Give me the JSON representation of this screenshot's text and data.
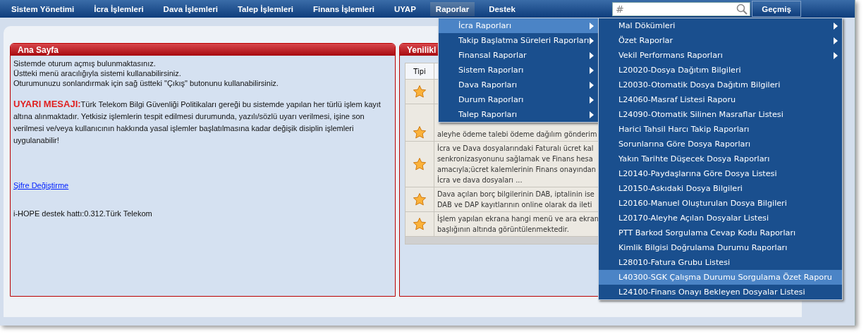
{
  "nav": {
    "items": [
      {
        "label": "Sistem Yönetimi",
        "selected": false
      },
      {
        "label": "İcra İşlemleri",
        "selected": false
      },
      {
        "label": "Dava İşlemleri",
        "selected": false
      },
      {
        "label": "Talep İşlemleri",
        "selected": false
      },
      {
        "label": "Finans İşlemleri",
        "selected": false
      },
      {
        "label": "UYAP",
        "selected": false
      },
      {
        "label": "Raporlar",
        "selected": true
      },
      {
        "label": "Destek",
        "selected": false
      }
    ],
    "search": {
      "placeholder": "#"
    },
    "history_button": "Geçmiş"
  },
  "home_panel": {
    "title": "Ana Sayfa",
    "lines": [
      "Sistemde oturum açmış bulunmaktasınız.",
      "Üstteki menü aracılığıyla sistemi kullanabilirsiniz.",
      "Oturumunuzu sonlandırmak için sağ üstteki \"Çıkış\" butonunu kullanabilirsiniz."
    ],
    "warning": "**UYARI MESAJI:**Türk Telekom Bilgi Güvenliği Politikaları gereği bu sistemde yapılan her türlü işlem kayıt altına alınmaktadır. Yetkisiz işlemlerin tespit edilmesi durumunda, yazılı/sözlü uyarı verilmesi, işine son verilmesi ve/veya kullanıcının hakkında yasal işlemler başlatılmasına kadar değişik disiplin işlemleri uygulanabilir!",
    "password_link": "Şifre Değiştirme",
    "support_line": "i-HOPE destek hattı:0.312.Türk Telekom"
  },
  "news_panel": {
    "title": "Yenilikl",
    "columns": [
      "Tipi"
    ],
    "rows": [
      {
        "kind": "star"
      },
      {
        "kind": "star",
        "lines": [
          "aleyhe ödeme talebi ödeme dağılım gönderim"
        ]
      },
      {
        "kind": "star",
        "lines": [
          "İcra ve Dava dosyalarındaki Faturalı ücret kal",
          "senkronizasyonunu sağlamak ve Finans hesa",
          "amacıyla;ücret kalemlerinin Finans onayından",
          "İcra ve dava dosyaları ..."
        ]
      },
      {
        "kind": "star",
        "lines": [
          "Dava açılan borç bilgilerinin DAB, iptalinin ise",
          "DAB ve DAP kayıtlarının online olarak da ileti"
        ]
      },
      {
        "kind": "star",
        "lines": [
          "İşlem yapılan ekrana hangi menü ve ara ekran",
          "başlığının altında görüntülenmektedir."
        ]
      }
    ]
  },
  "reports_menu": {
    "items": [
      {
        "label": "İcra Raporları",
        "submenu": true,
        "selected": true
      },
      {
        "label": "Takip Başlatma Süreleri Raporları",
        "submenu": true,
        "selected": false
      },
      {
        "label": "Finansal Raporlar",
        "submenu": true,
        "selected": false
      },
      {
        "label": "Sistem Raporları",
        "submenu": true,
        "selected": false
      },
      {
        "label": "Dava Raporları",
        "submenu": true,
        "selected": false
      },
      {
        "label": "Durum Raporları",
        "submenu": true,
        "selected": false
      },
      {
        "label": "Talep Raporları",
        "submenu": true,
        "selected": false
      }
    ]
  },
  "icra_submenu": {
    "items": [
      {
        "label": "Mal Dökümleri",
        "submenu": true,
        "selected": false
      },
      {
        "label": "Özet Raporlar",
        "submenu": true,
        "selected": false
      },
      {
        "label": "Vekil Performans Raporları",
        "submenu": true,
        "selected": false
      },
      {
        "label": "L20020-Dosya Dağıtım Bilgileri",
        "submenu": false,
        "selected": false
      },
      {
        "label": "L20030-Otomatik Dosya Dağıtım Bilgileri",
        "submenu": false,
        "selected": false
      },
      {
        "label": "L24060-Masraf Listesi Raporu",
        "submenu": false,
        "selected": false
      },
      {
        "label": "L24090-Otomatik Silinen Masraflar Listesi",
        "submenu": false,
        "selected": false
      },
      {
        "label": "Harici Tahsil Harcı Takip Raporları",
        "submenu": false,
        "selected": false
      },
      {
        "label": "Sorunlarına Göre Dosya Raporları",
        "submenu": false,
        "selected": false
      },
      {
        "label": "Yakın Tarihte Düşecek Dosya Raporları",
        "submenu": false,
        "selected": false
      },
      {
        "label": "L20140-Paydaşlarına Göre Dosya Listesi",
        "submenu": false,
        "selected": false
      },
      {
        "label": "L20150-Askıdaki Dosya Bilgileri",
        "submenu": false,
        "selected": false
      },
      {
        "label": "L20160-Manuel Oluşturulan Dosya Bilgileri",
        "submenu": false,
        "selected": false
      },
      {
        "label": "L20170-Aleyhe Açılan Dosyalar Listesi",
        "submenu": false,
        "selected": false
      },
      {
        "label": "PTT Barkod Sorgulama Cevap Kodu Raporları",
        "submenu": false,
        "selected": false
      },
      {
        "label": "Kimlik Bilgisi Doğrulama Durumu Raporları",
        "submenu": false,
        "selected": false
      },
      {
        "label": "L28010-Fatura Grubu Listesi",
        "submenu": false,
        "selected": false
      },
      {
        "label": "L40300-SGK Çalışma Durumu Sorgulama Özet Raporu",
        "submenu": false,
        "selected": true
      },
      {
        "label": "L24100-Finans Onayı Bekleyen Dosyalar Listesi",
        "submenu": false,
        "selected": false
      }
    ]
  }
}
